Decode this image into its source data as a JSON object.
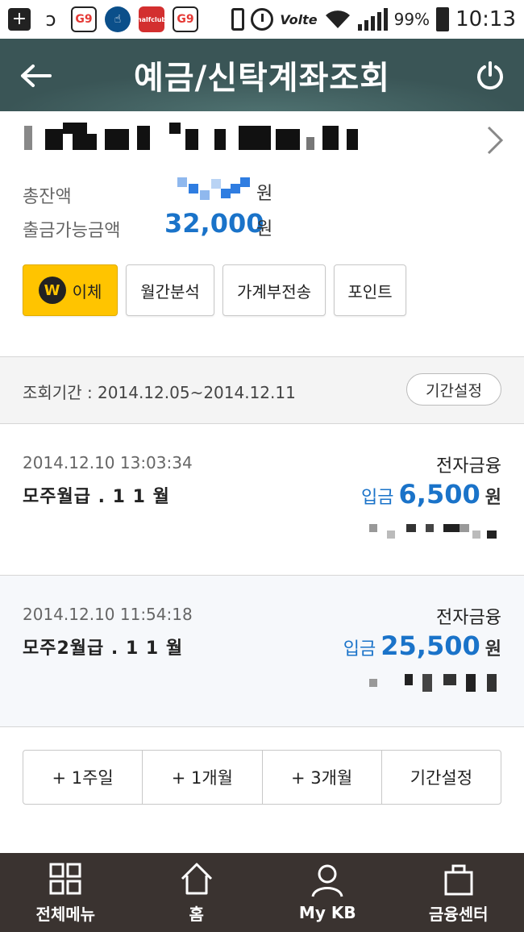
{
  "status_bar": {
    "battery": "99%",
    "time": "10:13",
    "app_labels": [
      "G9",
      "halfclub",
      "G9"
    ],
    "network": "Volte"
  },
  "header": {
    "title": "예금/신탁계좌조회"
  },
  "account": {
    "total_label": "총잔액",
    "available_label": "출금가능금액",
    "available_amount": "32,000",
    "currency": "원"
  },
  "actions": {
    "transfer_label": "이체",
    "transfer_icon_text": "W",
    "monthly_label": "월간분석",
    "ledger_label": "가계부전송",
    "point_label": "포인트"
  },
  "period": {
    "text": "조회기간 : 2014.12.05~2014.12.11",
    "set_label": "기간설정"
  },
  "transactions": [
    {
      "datetime": "2014.12.10 13:03:34",
      "type": "전자금융",
      "description": "모주월급 . 1 1 월",
      "kind": "입금",
      "amount": "6,500",
      "currency": "원"
    },
    {
      "datetime": "2014.12.10 11:54:18",
      "type": "전자금융",
      "description": "모주2월급 . 1 1 월",
      "kind": "입금",
      "amount": "25,500",
      "currency": "원"
    }
  ],
  "quick_periods": [
    "+ 1주일",
    "+ 1개월",
    "+ 3개월",
    "기간설정"
  ],
  "bottom_nav": [
    {
      "label": "전체메뉴",
      "icon": "grid-icon"
    },
    {
      "label": "홈",
      "icon": "home-icon"
    },
    {
      "label": "My KB",
      "icon": "person-icon"
    },
    {
      "label": "금융센터",
      "icon": "bag-icon"
    }
  ],
  "colors": {
    "header_bg": "#3a5556",
    "accent_blue": "#1a73c9",
    "transfer_yellow": "#ffc400",
    "nav_bg": "#3a3330"
  }
}
